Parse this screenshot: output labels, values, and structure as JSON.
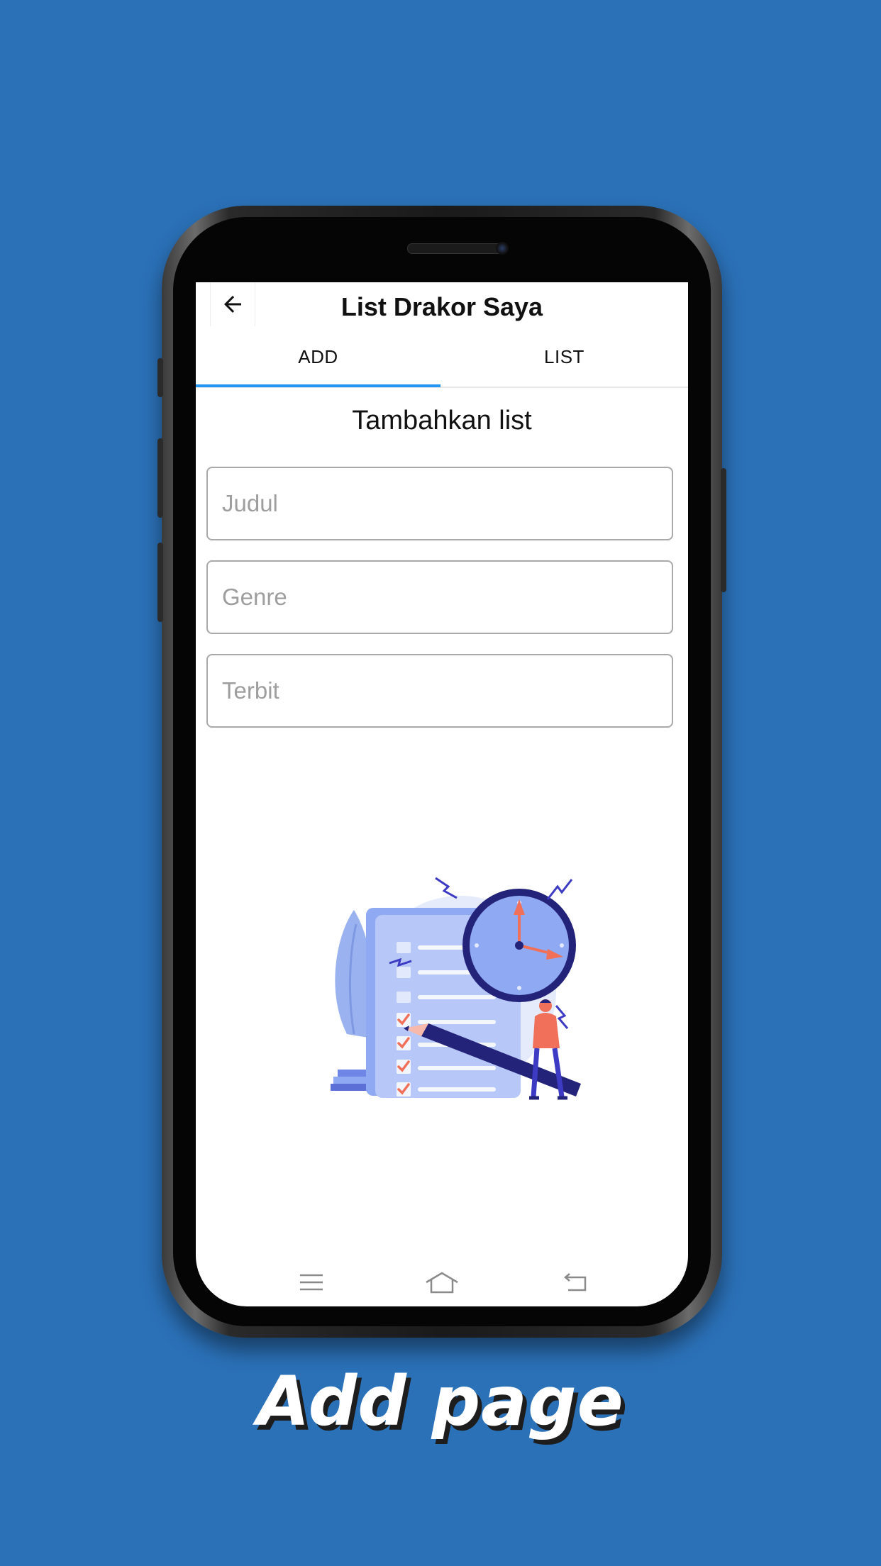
{
  "app": {
    "title": "List Drakor Saya",
    "back_icon": "arrow-left-icon"
  },
  "tabs": [
    {
      "label": "ADD",
      "selected": true
    },
    {
      "label": "LIST",
      "selected": false
    }
  ],
  "form": {
    "heading": "Tambahkan list",
    "fields": [
      {
        "placeholder": "Judul",
        "value": ""
      },
      {
        "placeholder": "Genre",
        "value": ""
      },
      {
        "placeholder": "Terbit",
        "value": ""
      }
    ]
  },
  "illustration": {
    "icon": "checklist-clock-illustration"
  },
  "system_nav": {
    "icons": [
      "menu-icon",
      "home-icon",
      "back-icon"
    ]
  },
  "caption": "Add page",
  "colors": {
    "background": "#2B71B8",
    "tab_indicator": "#2196F3",
    "illustration_primary": "#8FA9F2",
    "illustration_accent": "#F0705A",
    "illustration_dark": "#24237A"
  }
}
